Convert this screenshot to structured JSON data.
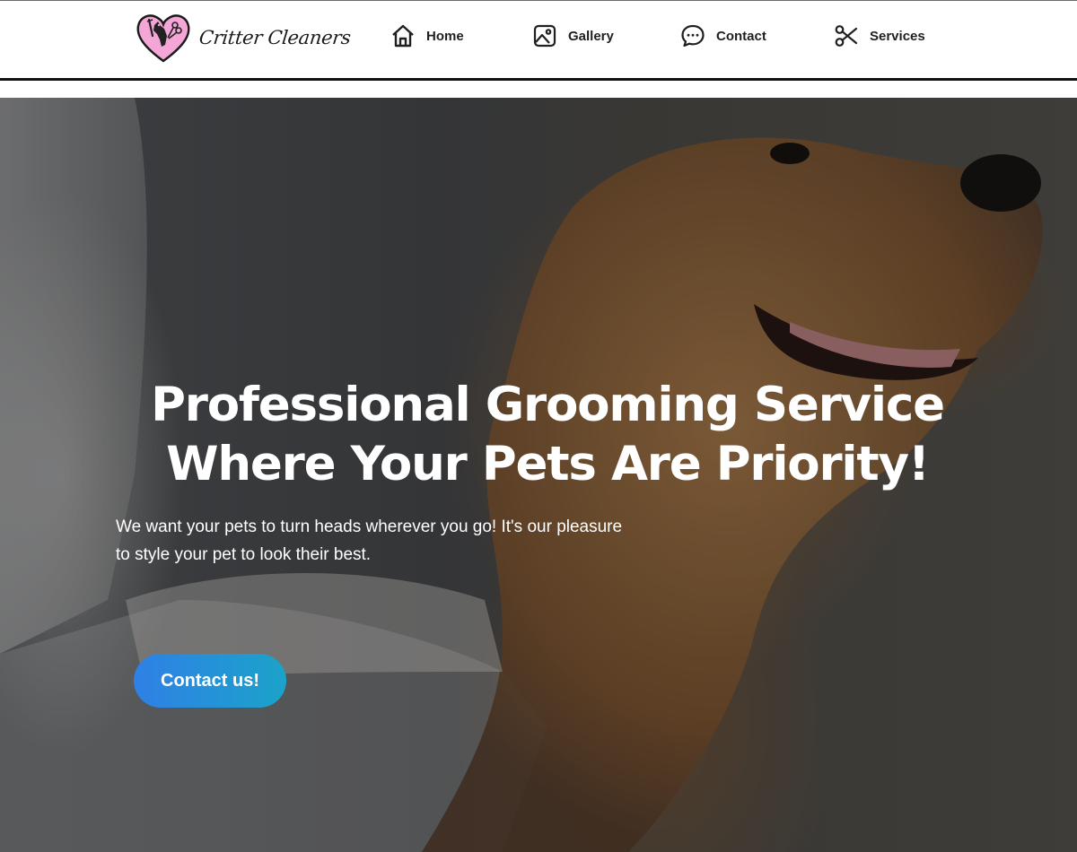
{
  "brand": {
    "name": "Critter Cleaners",
    "logo_icon": "heart-dog-scissors-icon",
    "logo_color": "#f4a6d7"
  },
  "nav": {
    "items": [
      {
        "label": "Home",
        "icon": "home-icon"
      },
      {
        "label": "Gallery",
        "icon": "image-icon"
      },
      {
        "label": "Contact",
        "icon": "chat-bubble-icon"
      },
      {
        "label": "Services",
        "icon": "scissors-icon"
      }
    ]
  },
  "hero": {
    "title_line1": "Professional Grooming Service",
    "title_line2": "Where Your Pets Are Priority!",
    "subtitle_line1": "We want your pets to turn heads wherever you go! It's our pleasure",
    "subtitle_line2": "to style your pet to look their best.",
    "cta_label": "Contact us!",
    "cta_gradient": [
      "#2f80e6",
      "#1ba3c9"
    ]
  },
  "colors": {
    "header_bg": "#ffffff",
    "header_rule": "#111111",
    "text_dark": "#1f1f1f",
    "hero_text": "#ffffff"
  }
}
